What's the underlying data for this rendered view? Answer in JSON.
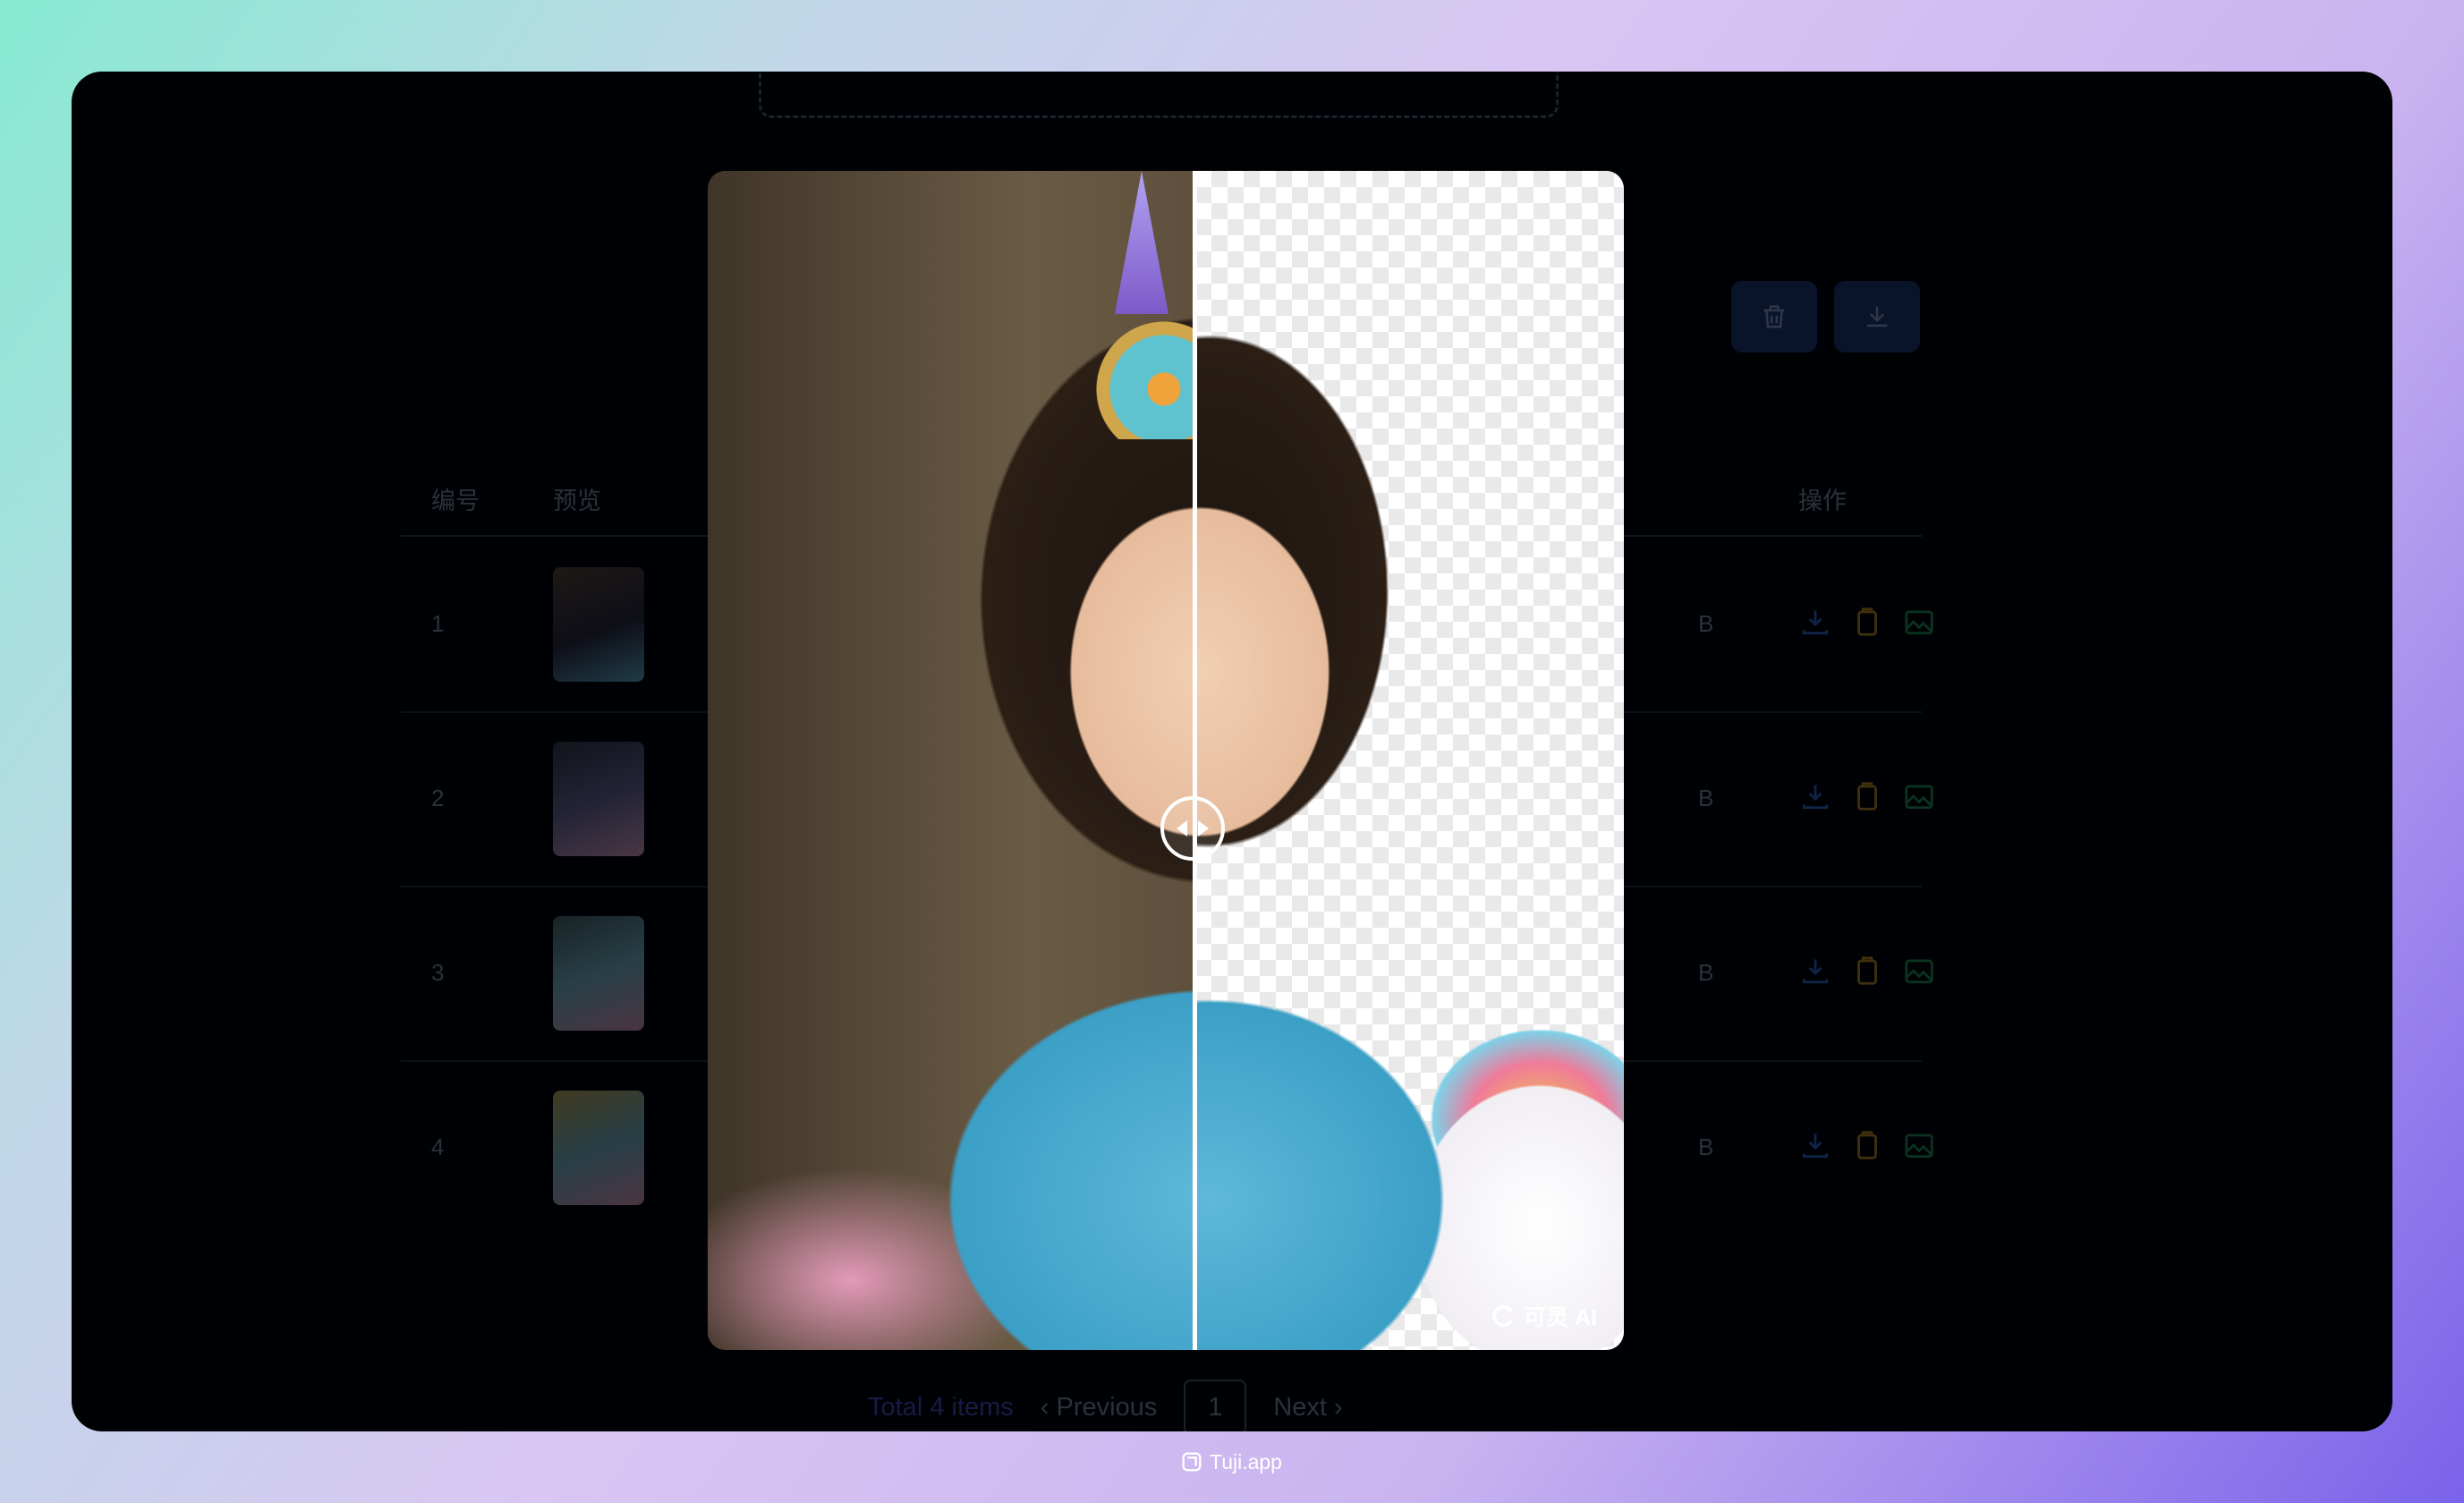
{
  "colors": {
    "accent": "#4a52c8",
    "button_bg": "#1d3a78",
    "download_icon": "#2f6fd6",
    "copy_icon": "#c99521",
    "image_icon": "#1f9a56"
  },
  "toolbar": {
    "delete_icon": "trash-icon",
    "download_all_icon": "download-icon"
  },
  "table": {
    "headers": {
      "no": "编号",
      "preview": "预览",
      "actions": "操作"
    },
    "rows": [
      {
        "no": "1",
        "size_suffix": "B"
      },
      {
        "no": "2",
        "size_suffix": "B"
      },
      {
        "no": "3",
        "size_suffix": "B"
      },
      {
        "no": "4",
        "size_suffix": "B"
      }
    ]
  },
  "pagination": {
    "total": "Total 4 items",
    "previous": "Previous",
    "page": "1",
    "next": "Next"
  },
  "compare": {
    "watermark": "可灵 AI"
  },
  "footer": {
    "brand": "Tuji.app"
  }
}
